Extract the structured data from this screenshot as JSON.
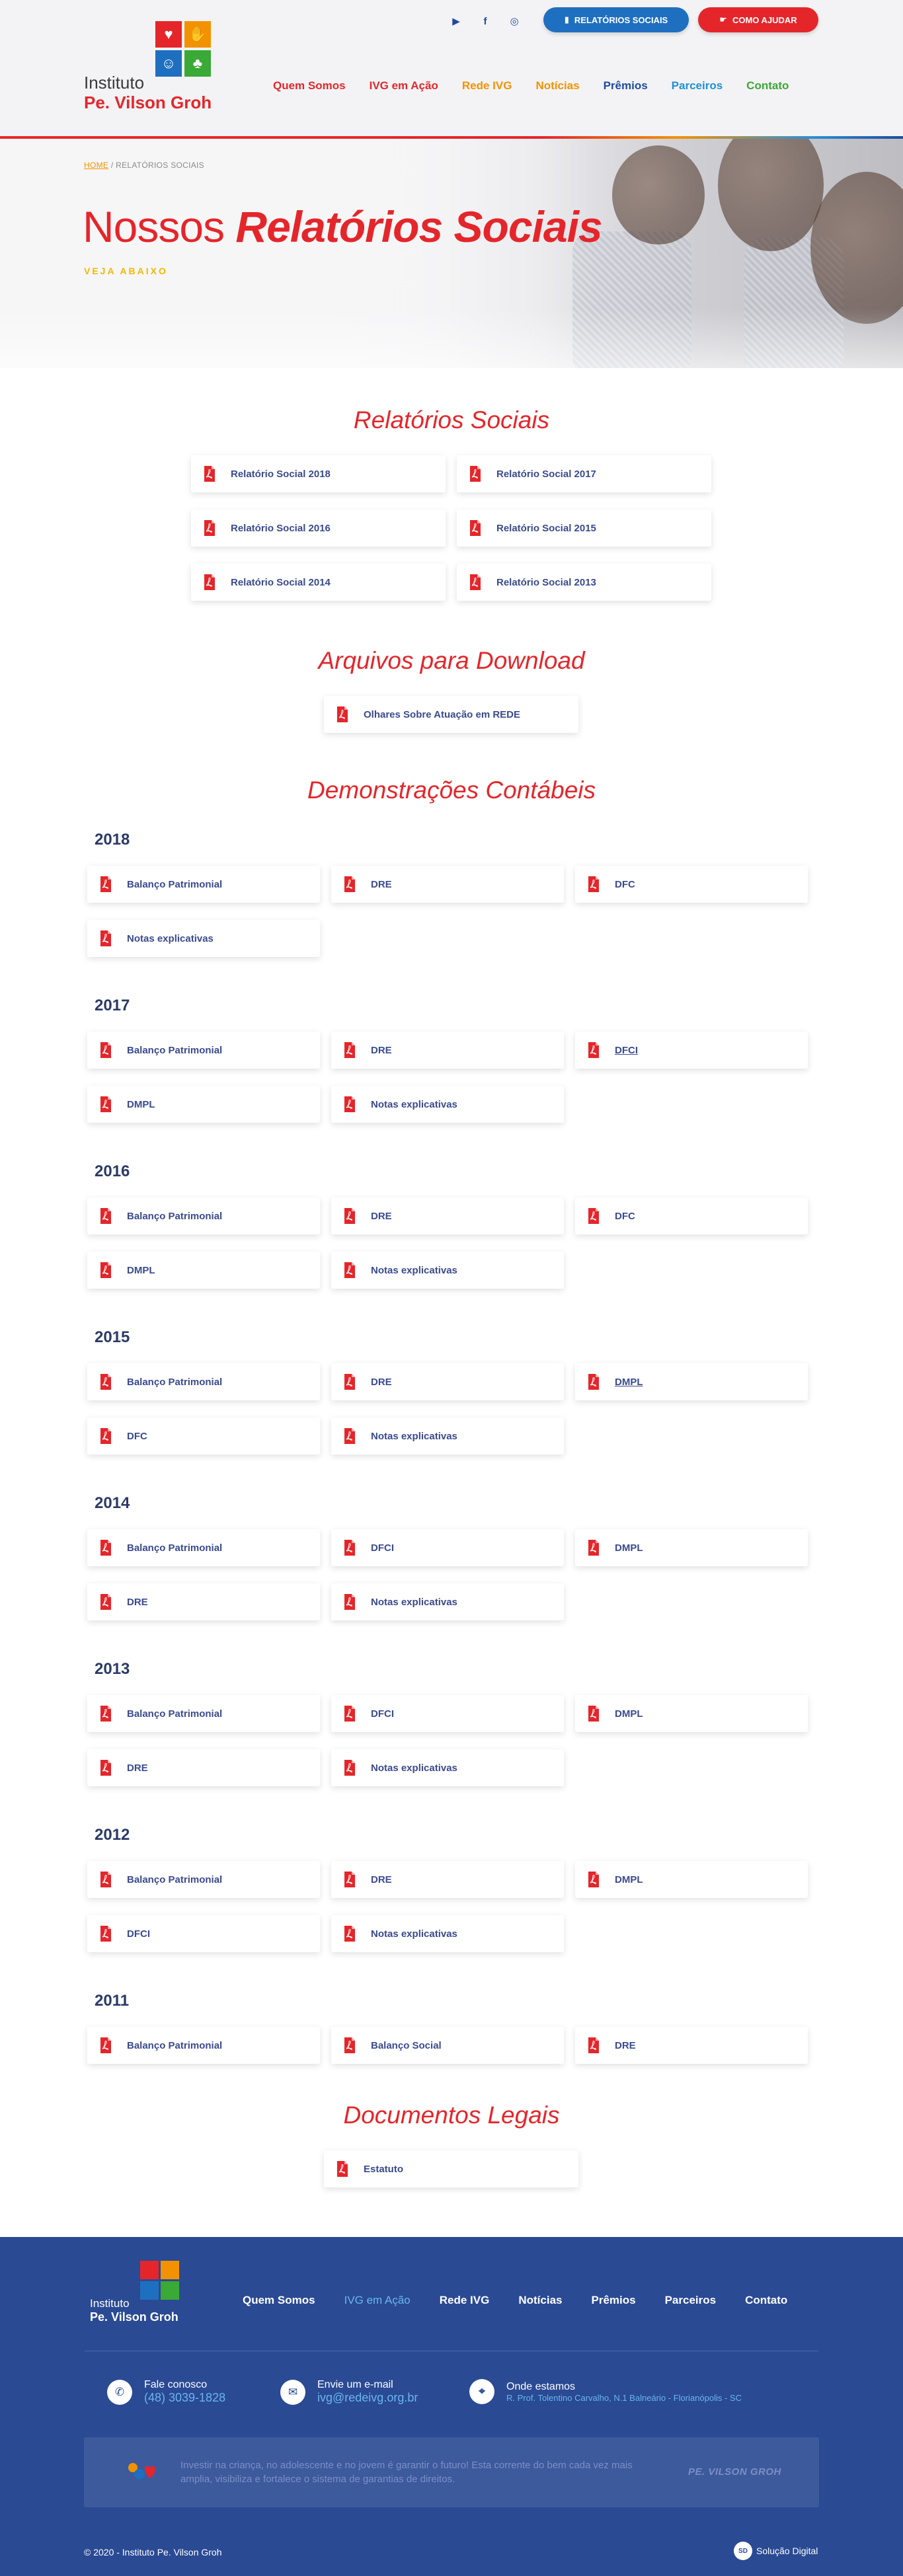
{
  "header": {
    "social": [
      {
        "icon": "youtube-icon",
        "glyph": "▶"
      },
      {
        "icon": "facebook-icon",
        "glyph": "f"
      },
      {
        "icon": "instagram-icon",
        "glyph": "◎"
      }
    ],
    "btn_relatorios": "RELATÓRIOS SOCIAIS",
    "btn_como_ajudar": "COMO AJUDAR",
    "logo_line1": "Instituto",
    "logo_line2": "Pe. Vilson Groh",
    "nav": [
      {
        "label": "Quem Somos",
        "color": "#e4262b"
      },
      {
        "label": "IVG em Ação",
        "color": "#e4262b"
      },
      {
        "label": "Rede IVG",
        "color": "#f39200"
      },
      {
        "label": "Notícias",
        "color": "#f39200"
      },
      {
        "label": "Prêmios",
        "color": "#1f4aa0"
      },
      {
        "label": "Parceiros",
        "color": "#1f8fd6"
      },
      {
        "label": "Contato",
        "color": "#3aa935"
      }
    ]
  },
  "hero": {
    "breadcrumb_home": "HOME",
    "breadcrumb_current": " / RELATÓRIOS SOCIAIS",
    "title_light": "Nossos ",
    "title_bold": "Relatórios Sociais",
    "subtitle": "VEJA ABAIXO"
  },
  "relatorios": {
    "title": "Relatórios Sociais",
    "items": [
      "Relatório Social 2018",
      "Relatório Social 2017",
      "Relatório Social 2016",
      "Relatório Social 2015",
      "Relatório Social 2014",
      "Relatório Social 2013"
    ]
  },
  "downloads": {
    "title": "Arquivos para Download",
    "items": [
      "Olhares Sobre Atuação em REDE"
    ]
  },
  "contabeis": {
    "title": "Demonstrações Contábeis",
    "years": [
      {
        "year": "2018",
        "docs": [
          "Balanço Patrimonial",
          "DRE",
          "DFC",
          "Notas explicativas"
        ]
      },
      {
        "year": "2017",
        "docs": [
          "Balanço Patrimonial",
          "DRE",
          "DFCI",
          "DMPL",
          "Notas explicativas"
        ]
      },
      {
        "year": "2016",
        "docs": [
          "Balanço Patrimonial",
          "DRE",
          "DFC",
          "DMPL",
          "Notas explicativas"
        ]
      },
      {
        "year": "2015",
        "docs": [
          "Balanço Patrimonial",
          "DRE",
          "DMPL",
          "DFC",
          "Notas explicativas"
        ]
      },
      {
        "year": "2014",
        "docs": [
          "Balanço Patrimonial",
          "DFCI",
          "DMPL",
          "DRE",
          "Notas explicativas"
        ]
      },
      {
        "year": "2013",
        "docs": [
          "Balanço Patrimonial",
          "DFCI",
          "DMPL",
          "DRE",
          "Notas explicativas"
        ]
      },
      {
        "year": "2012",
        "docs": [
          "Balanço Patrimonial",
          "DRE",
          "DMPL",
          "DFCI",
          "Notas explicativas"
        ]
      },
      {
        "year": "2011",
        "docs": [
          "Balanço Patrimonial",
          "Balanço Social",
          "DRE"
        ]
      }
    ]
  },
  "legais": {
    "title": "Documentos Legais",
    "items": [
      "Estatuto"
    ]
  },
  "footer": {
    "logo_line1": "Instituto",
    "logo_line2": "Pe. Vilson Groh",
    "nav": [
      "Quem Somos",
      "IVG em Ação",
      "Rede IVG",
      "Notícias",
      "Prêmios",
      "Parceiros",
      "Contato"
    ],
    "phone_label": "Fale conosco",
    "phone_value": "(48) 3039-1828",
    "email_label": "Envie um e-mail",
    "email_value": "ivg@redeivg.org.br",
    "address_label": "Onde estamos",
    "address_value": "R. Prof. Tolentino Carvalho, N.1 Balneário - Florianópolis - SC",
    "quote": "Investir na criança, no adolescente e no jovem é garantir o futuro! Esta corrente do bem cada vez mais amplia, visibiliza e fortalece o sistema de garantias de direitos.",
    "quote_author": "PE. VILSON GROH",
    "copyright": "© 2020 - Instituto Pe. Vilson Groh",
    "credit": "Solução Digital",
    "credit_badge": "SD"
  }
}
